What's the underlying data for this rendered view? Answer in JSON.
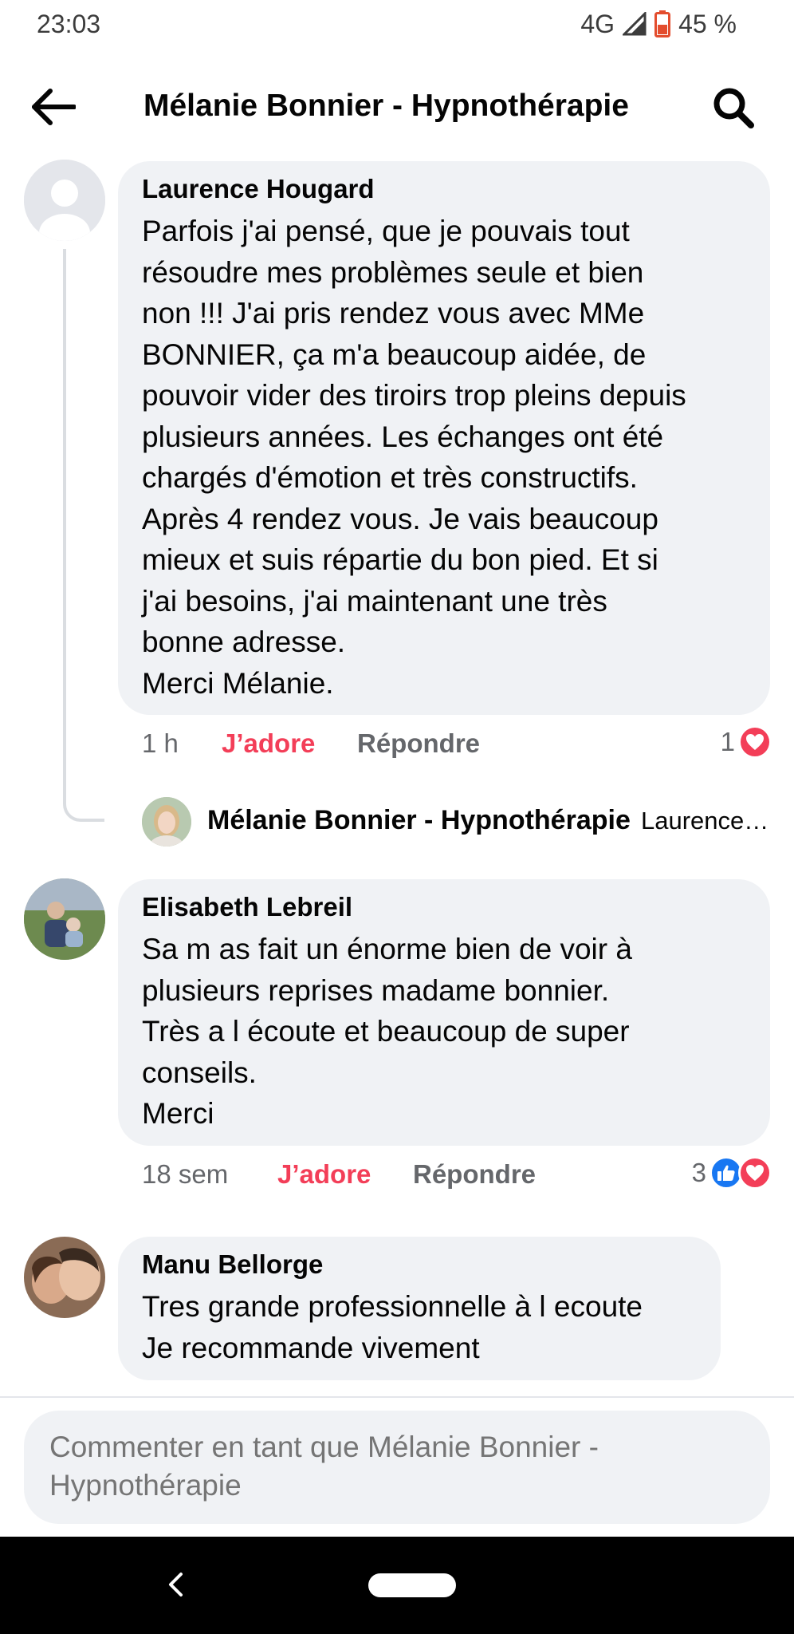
{
  "status": {
    "time": "23:03",
    "network": "4G",
    "battery": "45 %"
  },
  "header": {
    "title": "Mélanie Bonnier - Hypnothérapie"
  },
  "comments": [
    {
      "author": "Laurence Hougard",
      "text": "Parfois j'ai pensé,  que je pouvais tout\nrésoudre mes problèmes  seule et bien\nnon !!! J'ai pris rendez vous avec MMe\nBONNIER, ça  m'a beaucoup aidée, de\npouvoir vider des tiroirs trop pleins depuis\nplusieurs années. Les échanges ont été\nchargés  d'émotion et très constructifs.\nAprès 4 rendez vous. Je vais beaucoup\nmieux et suis répartie  du bon pied. Et si\nj'ai besoins, j'ai maintenant une très\nbonne adresse.\nMerci Mélanie.",
      "time": "1 h",
      "love_label": "J’adore",
      "reply_label": "Répondre",
      "reaction_count": "1",
      "reactions": [
        "love"
      ]
    },
    {
      "author": "Elisabeth Lebreil",
      "text": "Sa m as fait un énorme bien de voir à\nplusieurs reprises madame bonnier.\nTrès a l écoute et beaucoup de super\nconseils.\nMerci",
      "time": "18 sem",
      "love_label": "J’adore",
      "reply_label": "Répondre",
      "reaction_count": "3",
      "reactions": [
        "like",
        "love"
      ]
    },
    {
      "author": "Manu Bellorge",
      "text": "Tres grande professionnelle à l ecoute\nJe recommande vivement"
    }
  ],
  "reply": {
    "author": "Mélanie Bonnier - Hypnothérapie",
    "preview": "Laurence…"
  },
  "compose": {
    "placeholder": "Commenter en tant que Mélanie Bonnier -\nHypnothérapie"
  },
  "colors": {
    "love": "#f33e58",
    "like": "#1877f2",
    "bubble": "#f0f2f5",
    "secondary_text": "#65676b"
  }
}
